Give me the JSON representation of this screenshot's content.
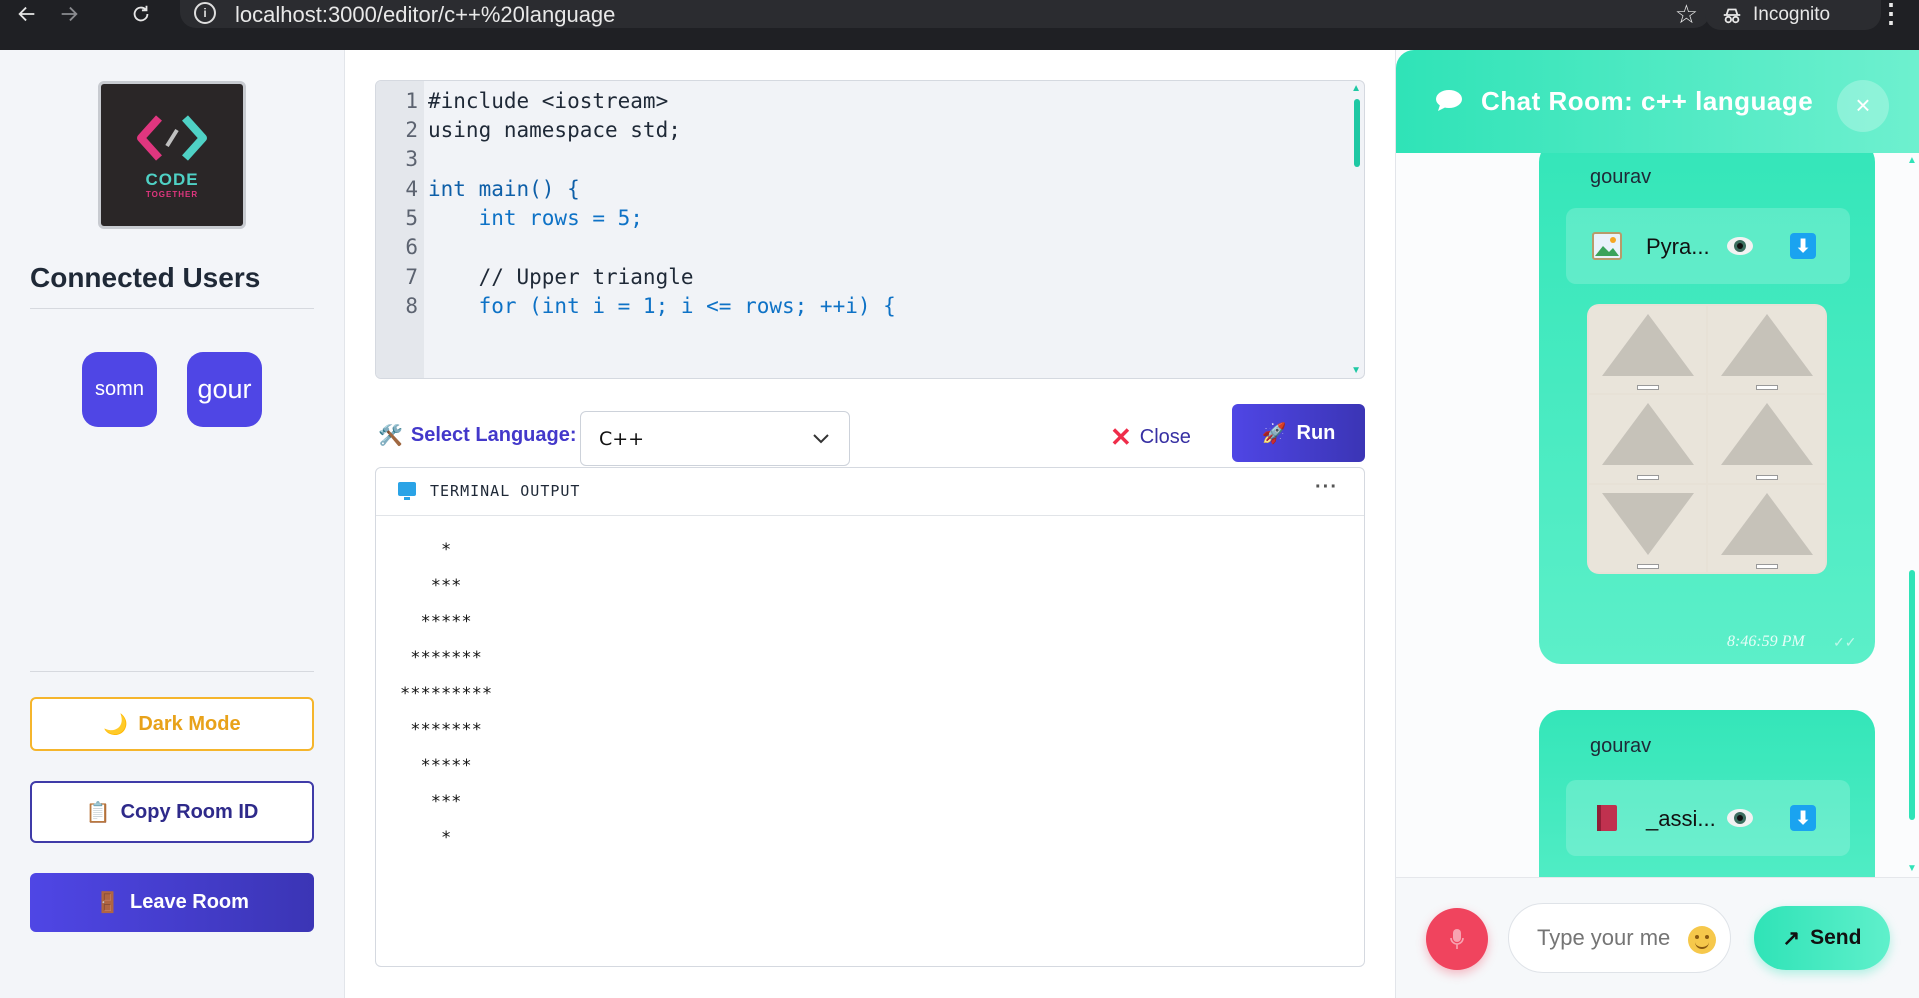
{
  "browser": {
    "url": "localhost:3000/editor/c++%20language",
    "incognito_label": "Incognito"
  },
  "sidebar": {
    "logo_text": "CODE",
    "logo_subtext": "TOGETHER",
    "connected_title": "Connected Users",
    "users": [
      "somn",
      "gour"
    ],
    "dark_mode_label": "Dark Mode",
    "copy_room_label": "Copy Room ID",
    "leave_room_label": "Leave Room"
  },
  "editor": {
    "line_numbers": [
      "1",
      "2",
      "3",
      "4",
      "5",
      "6",
      "7",
      "8"
    ],
    "lines": [
      "#include <iostream>",
      "using namespace std;",
      "",
      "int main() {",
      "    int rows = 5;",
      "",
      "    // Upper triangle",
      "    for (int i = 1; i <= rows; ++i) {"
    ]
  },
  "toolbar": {
    "select_language_label": "Select Language:",
    "selected_language": "C++",
    "close_label": "Close",
    "run_label": "Run"
  },
  "terminal": {
    "title": "TERMINAL OUTPUT",
    "more": "···",
    "output": [
      "    *",
      "   ***",
      "  *****",
      " *******",
      "*********",
      " *******",
      "  *****",
      "   ***",
      "    *"
    ]
  },
  "chat": {
    "title": "Chat Room: c++ language",
    "close": "×",
    "messages": [
      {
        "sender": "gourav",
        "file_name": "Pyra...",
        "file_icon": "image-file-icon",
        "time": "8:46:59 PM",
        "check": "✓✓"
      },
      {
        "sender": "gourav",
        "file_name": "_assi...",
        "file_icon": "book-file-icon"
      }
    ],
    "input_placeholder": "Type your me",
    "send_label": "Send"
  },
  "colors": {
    "primary": "#4f46e5",
    "accent": "#2fe3b7",
    "danger": "#ef2d4a",
    "warning": "#f5b52c"
  }
}
